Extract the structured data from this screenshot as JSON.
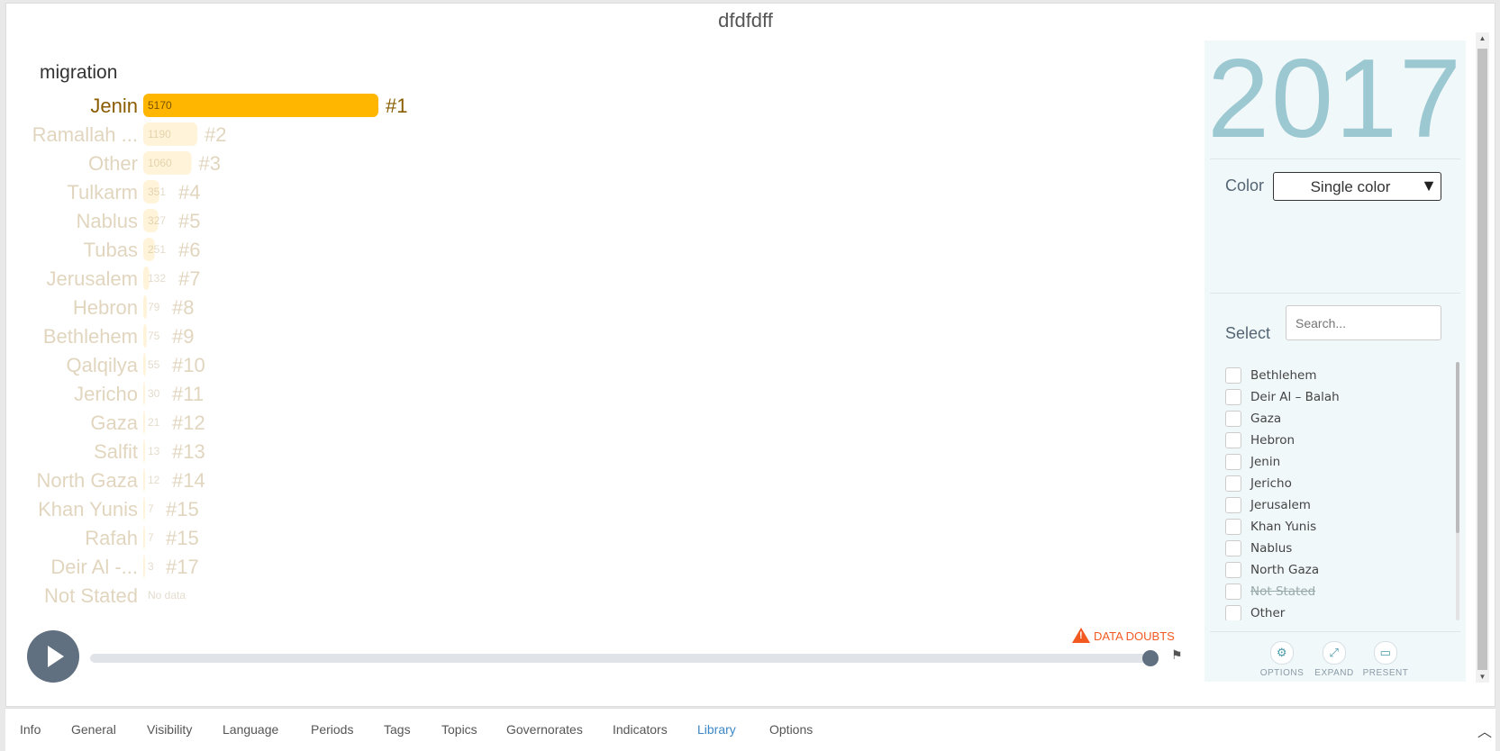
{
  "title": "dfdfdff",
  "chart_data": {
    "type": "bar",
    "title": "migration",
    "categories": [
      "Jenin",
      "Ramallah ...",
      "Other",
      "Tulkarm",
      "Nablus",
      "Tubas",
      "Jerusalem",
      "Hebron",
      "Bethlehem",
      "Qalqilya",
      "Jericho",
      "Gaza",
      "Salfit",
      "North Gaza",
      "Khan Yunis",
      "Rafah",
      "Deir Al -...",
      "Not Stated"
    ],
    "values": [
      5170,
      1190,
      1060,
      351,
      327,
      251,
      132,
      79,
      75,
      55,
      30,
      21,
      13,
      12,
      7,
      7,
      3,
      null
    ],
    "value_labels": [
      "5170",
      "1190",
      "1060",
      "351",
      "327",
      "251",
      "132",
      "79",
      "75",
      "55",
      "30",
      "21",
      "13",
      "12",
      "7",
      "7",
      "3",
      "No data"
    ],
    "ranks": [
      "#1",
      "#2",
      "#3",
      "#4",
      "#5",
      "#6",
      "#7",
      "#8",
      "#9",
      "#10",
      "#11",
      "#12",
      "#13",
      "#14",
      "#15",
      "#15",
      "#17",
      ""
    ],
    "highlighted": "Jenin",
    "bar_color": "#ffb600",
    "label_color": "#8a5c00",
    "year": "2017"
  },
  "sidebar": {
    "year": "2017",
    "color_label": "Color",
    "color_value": "Single color",
    "color_arrow": "▼",
    "select_label": "Select",
    "search_placeholder": "Search...",
    "items": [
      {
        "name": "Bethlehem",
        "strike": false
      },
      {
        "name": "Deir Al – Balah",
        "strike": false
      },
      {
        "name": "Gaza",
        "strike": false
      },
      {
        "name": "Hebron",
        "strike": false
      },
      {
        "name": "Jenin",
        "strike": false
      },
      {
        "name": "Jericho",
        "strike": false
      },
      {
        "name": "Jerusalem",
        "strike": false
      },
      {
        "name": "Khan Yunis",
        "strike": false
      },
      {
        "name": "Nablus",
        "strike": false
      },
      {
        "name": "North Gaza",
        "strike": false
      },
      {
        "name": "Not Stated",
        "strike": true
      },
      {
        "name": "Other",
        "strike": false
      }
    ],
    "tools": {
      "options": "OPTIONS",
      "expand": "EXPAND",
      "present": "PRESENT"
    }
  },
  "timeline": {
    "data_doubts": "DATA DOUBTS",
    "progress": 1.0
  },
  "tabs": [
    "Info",
    "General",
    "Visibility",
    "Language",
    "Periods",
    "Tags",
    "Topics",
    "Governorates",
    "Indicators",
    "Library",
    "Options"
  ],
  "active_tab": "Library"
}
